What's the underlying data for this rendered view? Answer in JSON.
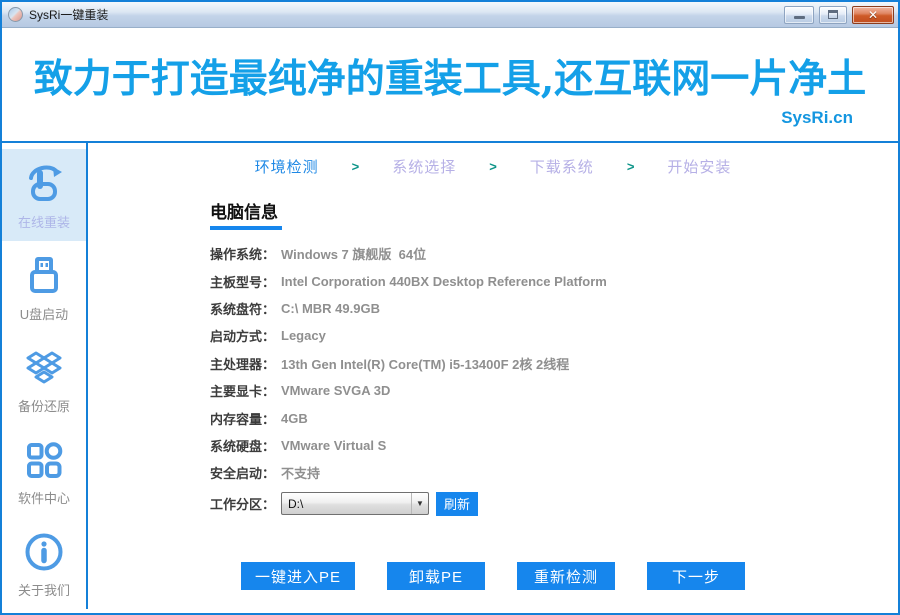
{
  "window": {
    "title": "SysRi一键重装"
  },
  "header": {
    "slogan": "致力于打造最纯净的重装工具,还互联网一片净土",
    "site": "SysRi.cn"
  },
  "sidebar": {
    "items": [
      {
        "label": "在线重装",
        "icon": "hand-redo-icon",
        "active": true
      },
      {
        "label": "U盘启动",
        "icon": "usb-drive-icon",
        "active": false
      },
      {
        "label": "备份还原",
        "icon": "backup-box-icon",
        "active": false
      },
      {
        "label": "软件中心",
        "icon": "app-grid-icon",
        "active": false
      },
      {
        "label": "关于我们",
        "icon": "info-circle-icon",
        "active": false
      }
    ]
  },
  "steps": {
    "separator": ">",
    "items": [
      {
        "label": "环境检测",
        "active": true
      },
      {
        "label": "系统选择",
        "active": false
      },
      {
        "label": "下载系统",
        "active": false
      },
      {
        "label": "开始安装",
        "active": false
      }
    ]
  },
  "main": {
    "section_title": "电脑信息",
    "info_rows": [
      {
        "label": "操作系统：",
        "value": "Windows 7 旗舰版  64位"
      },
      {
        "label": "主板型号：",
        "value": "Intel Corporation 440BX Desktop Reference Platform"
      },
      {
        "label": "系统盘符：",
        "value": "C:\\ MBR 49.9GB"
      },
      {
        "label": "启动方式：",
        "value": "Legacy"
      },
      {
        "label": "主处理器：",
        "value": "13th Gen Intel(R) Core(TM) i5-13400F 2核 2线程"
      },
      {
        "label": "主要显卡：",
        "value": "VMware SVGA 3D"
      },
      {
        "label": "内存容量：",
        "value": "4GB"
      },
      {
        "label": "系统硬盘：",
        "value": "VMware Virtual S"
      },
      {
        "label": "安全启动：",
        "value": "不支持"
      }
    ],
    "partition": {
      "label": "工作分区：",
      "selected": "D:\\",
      "refresh_label": "刷新"
    },
    "buttons": [
      "一键进入PE",
      "卸载PE",
      "重新检测",
      "下一步"
    ]
  },
  "colors": {
    "primary_blue": "#1686ED",
    "header_text_blue": "#14A0E8",
    "frame_blue": "#1480D8",
    "step_active": "#1E88E5",
    "step_separator_teal": "#0C9488",
    "step_inactive": "#B6B0E6",
    "sidebar_icon_blue": "#4E9BE4",
    "sidebar_active_bg": "#D8EAF8",
    "sidebar_active_label": "#AEB6E8",
    "value_gray": "#8F8F8F"
  }
}
